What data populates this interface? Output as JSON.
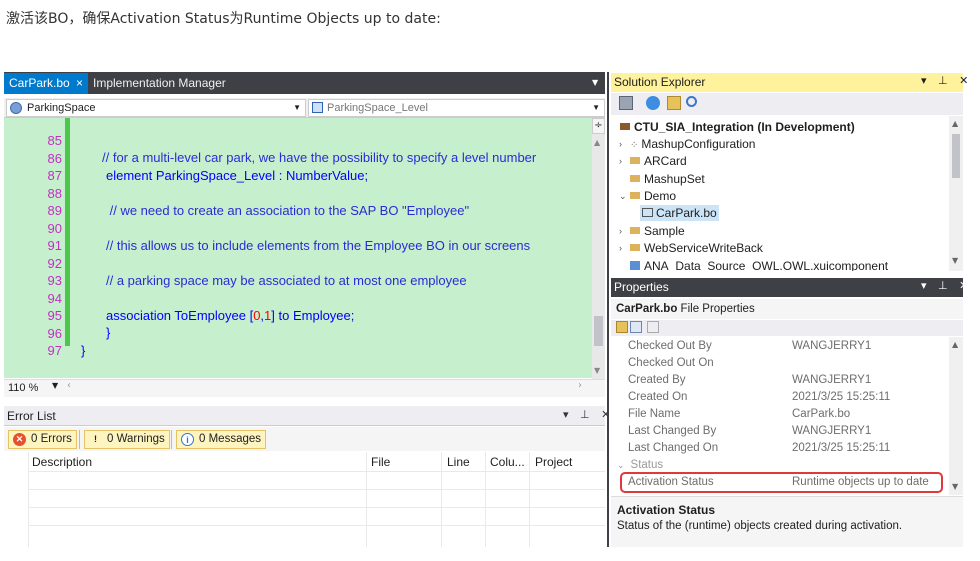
{
  "caption": "激活该BO，确保Activation Status为Runtime Objects up to date:",
  "editor": {
    "tab_active": "CarPark.bo",
    "tab_close": "×",
    "tab_other": "Implementation Manager",
    "nav_left": "ParkingSpace",
    "nav_right": "ParkingSpace_Level",
    "zoom": "110 %",
    "lines": [
      {
        "n": "85",
        "text": "// for a multi-level car park, we have the possibility to specify a level number"
      },
      {
        "n": "86",
        "text": "element ParkingSpace_Level : NumberValue;"
      },
      {
        "n": "87",
        "text": ""
      },
      {
        "n": "88",
        "text": " // we need to create an association to the SAP BO \"Employee\""
      },
      {
        "n": "89",
        "text": ""
      },
      {
        "n": "90",
        "text": "// this allows us to include elements from the Employee BO in our screens"
      },
      {
        "n": "91",
        "text": ""
      },
      {
        "n": "92",
        "text": "// a parking space may be associated to at most one employee"
      },
      {
        "n": "93",
        "text": ""
      },
      {
        "n": "94",
        "text_a": "association ToEmployee [",
        "text_n1": "0",
        "text_b": ",",
        "text_n2": "1",
        "text_c": "] to Employee;"
      },
      {
        "n": "95",
        "text": "}"
      },
      {
        "n": "96",
        "text": "}"
      },
      {
        "n": "97",
        "text": ""
      }
    ]
  },
  "error_list": {
    "title": "Error List",
    "errors": "0 Errors",
    "warnings": "0 Warnings",
    "messages": "0 Messages",
    "columns": [
      "Description",
      "File",
      "Line",
      "Colu...",
      "Project"
    ]
  },
  "solution_explorer": {
    "title": "Solution Explorer",
    "root": "CTU_SIA_Integration (In Development)",
    "items": [
      "MashupConfiguration",
      "ARCard",
      "MashupSet",
      "Demo",
      "CarPark.bo",
      "Sample",
      "WebServiceWriteBack",
      "ANA_Data_Source_OWL.OWL.xuicomponent"
    ]
  },
  "properties": {
    "title": "Properties",
    "subtitle_bold": "CarPark.bo",
    "subtitle_rest": " File Properties",
    "rows": [
      {
        "k": "Checked Out By",
        "v": "WANGJERRY1"
      },
      {
        "k": "Checked Out On",
        "v": ""
      },
      {
        "k": "Created By",
        "v": "WANGJERRY1"
      },
      {
        "k": "Created On",
        "v": "2021/3/25 15:25:11"
      },
      {
        "k": "File Name",
        "v": "CarPark.bo"
      },
      {
        "k": "Last Changed By",
        "v": "WANGJERRY1"
      },
      {
        "k": "Last Changed On",
        "v": "2021/3/25 15:25:11"
      }
    ],
    "category": "Status",
    "activation_key": "Activation Status",
    "activation_value": "Runtime objects up to date",
    "desc_title": "Activation Status",
    "desc_text": "Status of the (runtime) objects created during activation."
  },
  "colors": {
    "code_bg": "#c6efce",
    "accent": "#007acc",
    "explorer_title": "#fff29d",
    "highlight": "#e0383b"
  }
}
